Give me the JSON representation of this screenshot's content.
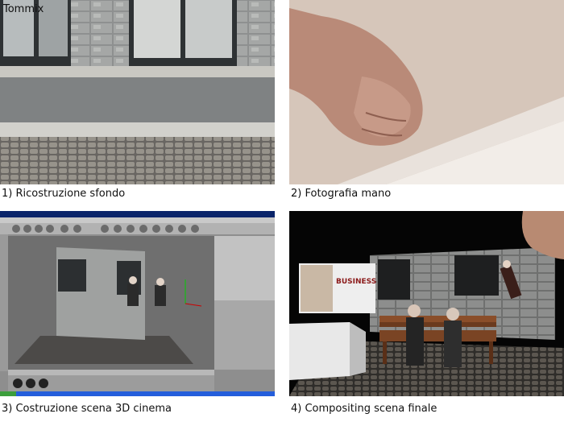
{
  "watermark": "Tommix",
  "panels": [
    {
      "caption": "1) Ricostruzione sfondo"
    },
    {
      "caption": "2) Fotografia mano"
    },
    {
      "caption": "3) Costruzione scena 3D cinema"
    },
    {
      "caption": "4) Compositing scena finale"
    }
  ],
  "sign_text": "BUSINESS"
}
